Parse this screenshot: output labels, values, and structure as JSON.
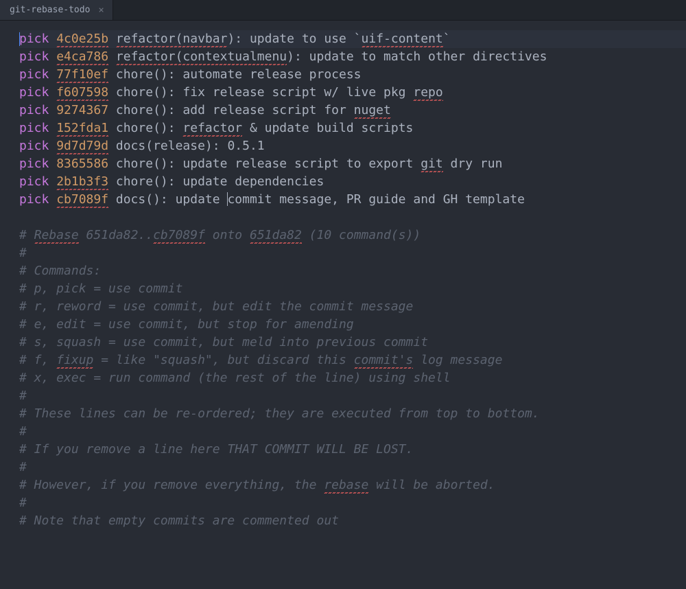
{
  "tab": {
    "title": "git-rebase-todo",
    "close": "×"
  },
  "lines": [
    {
      "kind": "pick",
      "current": true,
      "segs": [
        {
          "cls": "cmd",
          "t": "pick "
        },
        {
          "cls": "hash sp",
          "t": "4c0e25b"
        },
        {
          "cls": "msg",
          "t": " "
        },
        {
          "cls": "msg sp",
          "t": "refactor(navbar"
        },
        {
          "cls": "msg",
          "t": "): update to use `"
        },
        {
          "cls": "msg sp",
          "t": "uif-content"
        },
        {
          "cls": "msg",
          "t": "`"
        }
      ]
    },
    {
      "kind": "pick",
      "segs": [
        {
          "cls": "cmd",
          "t": "pick "
        },
        {
          "cls": "hash sp",
          "t": "e4ca786"
        },
        {
          "cls": "msg",
          "t": " "
        },
        {
          "cls": "msg sp",
          "t": "refactor(contextualmenu"
        },
        {
          "cls": "msg",
          "t": "): update to match other directives"
        }
      ]
    },
    {
      "kind": "pick",
      "segs": [
        {
          "cls": "cmd",
          "t": "pick "
        },
        {
          "cls": "hash sp",
          "t": "77f10ef"
        },
        {
          "cls": "msg",
          "t": " chore(): automate release process"
        }
      ]
    },
    {
      "kind": "pick",
      "segs": [
        {
          "cls": "cmd",
          "t": "pick "
        },
        {
          "cls": "hash sp",
          "t": "f607598"
        },
        {
          "cls": "msg",
          "t": " chore(): fix release script w/ live pkg "
        },
        {
          "cls": "msg sp",
          "t": "repo"
        }
      ]
    },
    {
      "kind": "pick",
      "segs": [
        {
          "cls": "cmd",
          "t": "pick "
        },
        {
          "cls": "hash",
          "t": "9274367"
        },
        {
          "cls": "msg",
          "t": " chore(): add release script for "
        },
        {
          "cls": "msg sp",
          "t": "nuget"
        }
      ]
    },
    {
      "kind": "pick",
      "segs": [
        {
          "cls": "cmd",
          "t": "pick "
        },
        {
          "cls": "hash sp",
          "t": "152fda1"
        },
        {
          "cls": "msg",
          "t": " chore(): "
        },
        {
          "cls": "msg sp",
          "t": "refactor"
        },
        {
          "cls": "msg",
          "t": " & update build scripts"
        }
      ]
    },
    {
      "kind": "pick",
      "segs": [
        {
          "cls": "cmd",
          "t": "pick "
        },
        {
          "cls": "hash sp",
          "t": "9d7d79d"
        },
        {
          "cls": "msg",
          "t": " docs(release): 0.5.1"
        }
      ]
    },
    {
      "kind": "pick",
      "segs": [
        {
          "cls": "cmd",
          "t": "pick "
        },
        {
          "cls": "hash",
          "t": "8365586"
        },
        {
          "cls": "msg",
          "t": " chore(): update release script to export "
        },
        {
          "cls": "msg sp",
          "t": "git"
        },
        {
          "cls": "msg",
          "t": " dry run"
        }
      ]
    },
    {
      "kind": "pick",
      "segs": [
        {
          "cls": "cmd",
          "t": "pick "
        },
        {
          "cls": "hash sp",
          "t": "2b1b3f3"
        },
        {
          "cls": "msg",
          "t": " chore(): update dependencies"
        }
      ]
    },
    {
      "kind": "pick",
      "segs": [
        {
          "cls": "cmd",
          "t": "pick "
        },
        {
          "cls": "hash sp",
          "t": "cb7089f"
        },
        {
          "cls": "msg",
          "t": " docs(): update "
        },
        {
          "cls": "msg caret-here",
          "t": ""
        },
        {
          "cls": "msg",
          "t": "commit message, PR guide and GH template"
        }
      ]
    },
    {
      "kind": "blank",
      "segs": [
        {
          "cls": "msg",
          "t": ""
        }
      ]
    },
    {
      "kind": "cmt",
      "segs": [
        {
          "cls": "cmt",
          "t": "# "
        },
        {
          "cls": "cmt sp",
          "t": "Rebase"
        },
        {
          "cls": "cmt",
          "t": " 651da82.."
        },
        {
          "cls": "cmt sp",
          "t": "cb7089f"
        },
        {
          "cls": "cmt",
          "t": " onto "
        },
        {
          "cls": "cmt sp",
          "t": "651da82"
        },
        {
          "cls": "cmt",
          "t": " (10 command(s))"
        }
      ]
    },
    {
      "kind": "cmt",
      "segs": [
        {
          "cls": "cmt",
          "t": "#"
        }
      ]
    },
    {
      "kind": "cmt",
      "segs": [
        {
          "cls": "cmt",
          "t": "# Commands:"
        }
      ]
    },
    {
      "kind": "cmt",
      "segs": [
        {
          "cls": "cmt",
          "t": "# p, pick = use commit"
        }
      ]
    },
    {
      "kind": "cmt",
      "segs": [
        {
          "cls": "cmt",
          "t": "# r, reword = use commit, but edit the commit message"
        }
      ]
    },
    {
      "kind": "cmt",
      "segs": [
        {
          "cls": "cmt",
          "t": "# e, edit = use commit, but stop for amending"
        }
      ]
    },
    {
      "kind": "cmt",
      "segs": [
        {
          "cls": "cmt",
          "t": "# s, squash = use commit, but meld into previous commit"
        }
      ]
    },
    {
      "kind": "cmt",
      "segs": [
        {
          "cls": "cmt",
          "t": "# f, "
        },
        {
          "cls": "cmt sp",
          "t": "fixup"
        },
        {
          "cls": "cmt",
          "t": " = like \"squash\", but discard this "
        },
        {
          "cls": "cmt sp",
          "t": "commit's"
        },
        {
          "cls": "cmt",
          "t": " log message"
        }
      ]
    },
    {
      "kind": "cmt",
      "segs": [
        {
          "cls": "cmt",
          "t": "# x, exec = run command (the rest of the line) using shell"
        }
      ]
    },
    {
      "kind": "cmt",
      "segs": [
        {
          "cls": "cmt",
          "t": "#"
        }
      ]
    },
    {
      "kind": "cmt",
      "segs": [
        {
          "cls": "cmt",
          "t": "# These lines can be re-ordered; they are executed from top to bottom."
        }
      ]
    },
    {
      "kind": "cmt",
      "segs": [
        {
          "cls": "cmt",
          "t": "#"
        }
      ]
    },
    {
      "kind": "cmt",
      "segs": [
        {
          "cls": "cmt",
          "t": "# If you remove a line here THAT COMMIT WILL BE LOST."
        }
      ]
    },
    {
      "kind": "cmt",
      "segs": [
        {
          "cls": "cmt",
          "t": "#"
        }
      ]
    },
    {
      "kind": "cmt",
      "segs": [
        {
          "cls": "cmt",
          "t": "# However, if you remove everything, the "
        },
        {
          "cls": "cmt sp",
          "t": "rebase"
        },
        {
          "cls": "cmt",
          "t": " will be aborted."
        }
      ]
    },
    {
      "kind": "cmt",
      "segs": [
        {
          "cls": "cmt",
          "t": "#"
        }
      ]
    },
    {
      "kind": "cmt",
      "segs": [
        {
          "cls": "cmt",
          "t": "# Note that empty commits are commented out"
        }
      ]
    }
  ]
}
